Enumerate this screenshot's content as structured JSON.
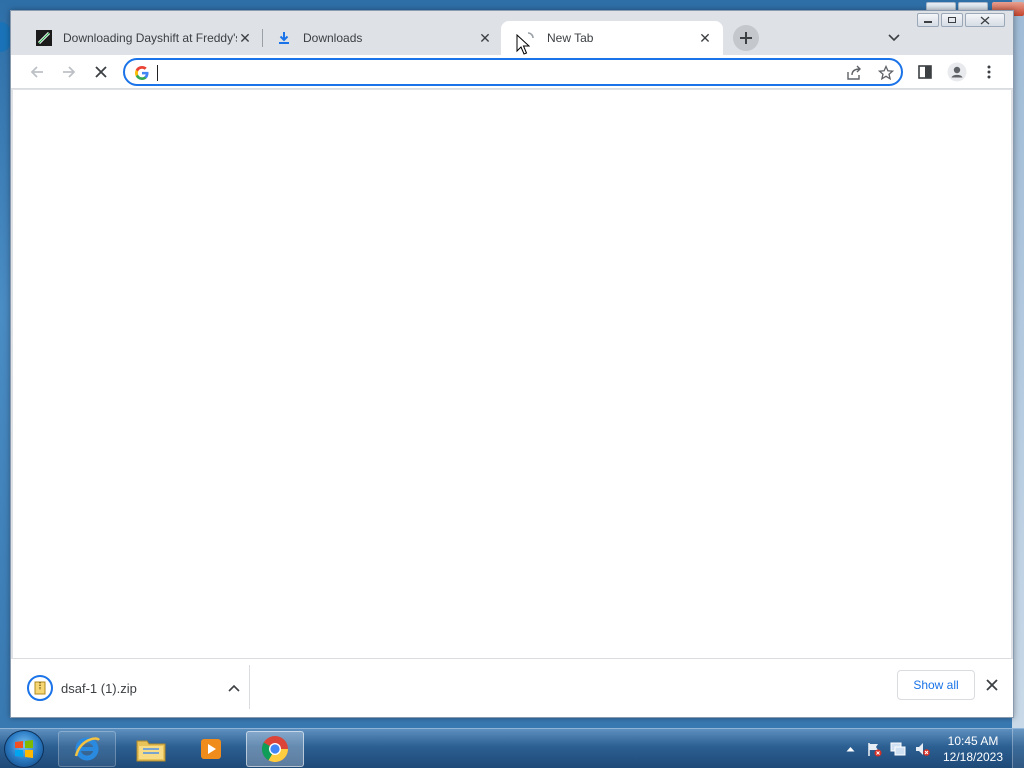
{
  "browser": {
    "tabs": [
      {
        "title": "Downloading Dayshift at Freddy's",
        "favicon": "fnaf-game-icon",
        "active": false
      },
      {
        "title": "Downloads",
        "favicon": "download-icon",
        "active": false
      },
      {
        "title": "New Tab",
        "favicon": "loading-spinner-icon",
        "active": true
      }
    ],
    "omnibox": {
      "value": "",
      "placeholder": ""
    },
    "colors": {
      "accent": "#1a73e8",
      "tabstrip": "#dee1e6",
      "page": "#ffffff"
    }
  },
  "download_shelf": {
    "item": {
      "filename": "dsaf-1 (1).zip",
      "icon": "zip-file-icon"
    },
    "show_all_label": "Show all"
  },
  "taskbar": {
    "pinned": [
      "internet-explorer-icon",
      "file-explorer-icon",
      "media-player-icon",
      "chrome-icon"
    ],
    "clock": {
      "time": "10:45 AM",
      "date": "12/18/2023"
    }
  }
}
